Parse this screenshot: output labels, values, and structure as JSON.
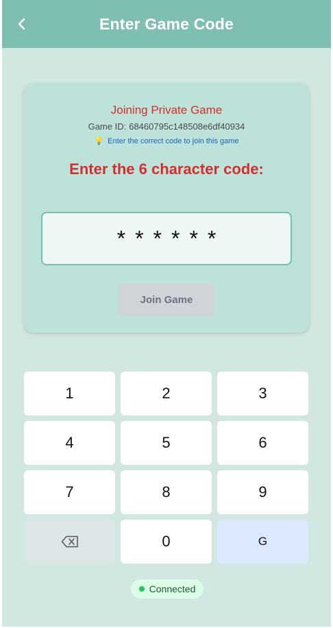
{
  "header": {
    "title": "Enter Game Code",
    "back_icon": "chevron-left-icon"
  },
  "card": {
    "title": "Joining Private Game",
    "game_id_label": "Game ID:",
    "game_id_value": "68460795c148508e6df40934",
    "hint_icon": "lightbulb-icon",
    "hint_text": "Enter the correct code to join this game",
    "prompt": "Enter the 6 character code:",
    "code_display": "******",
    "join_button": "Join Game"
  },
  "keypad": {
    "keys": [
      "1",
      "2",
      "3",
      "4",
      "5",
      "6",
      "7",
      "8",
      "9",
      "0",
      "G"
    ],
    "backspace_icon": "backspace-icon"
  },
  "status": {
    "text": "Connected",
    "color": "#22c55e"
  },
  "colors": {
    "header": "#7fbfb2",
    "background": "#d2e6e2",
    "card": "#bde2da",
    "accent_red": "#d32f2f"
  }
}
